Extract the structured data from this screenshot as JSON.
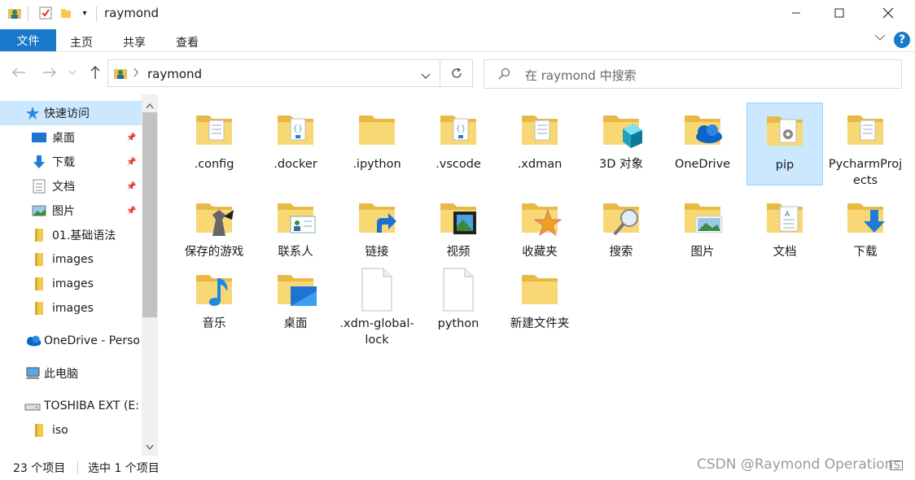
{
  "window": {
    "title": "raymond"
  },
  "ribbon": {
    "tabs": [
      "文件",
      "主页",
      "共享",
      "查看"
    ]
  },
  "address": {
    "path": "raymond",
    "search_placeholder": "在 raymond 中搜索"
  },
  "nav": {
    "items": [
      {
        "label": "快速访问",
        "icon": "star-icon"
      },
      {
        "label": "桌面",
        "icon": "desktop-icon",
        "pinned": true
      },
      {
        "label": "下载",
        "icon": "download-icon",
        "pinned": true
      },
      {
        "label": "文档",
        "icon": "document-icon",
        "pinned": true
      },
      {
        "label": "图片",
        "icon": "pictures-icon",
        "pinned": true
      },
      {
        "label": "01.基础语法",
        "icon": "folder-icon"
      },
      {
        "label": "images",
        "icon": "folder-icon"
      },
      {
        "label": "images",
        "icon": "folder-icon"
      },
      {
        "label": "images",
        "icon": "folder-icon"
      },
      {
        "label": "OneDrive - Perso",
        "icon": "onedrive-icon"
      },
      {
        "label": "此电脑",
        "icon": "computer-icon"
      },
      {
        "label": "TOSHIBA EXT (E:",
        "icon": "drive-icon"
      },
      {
        "label": "iso",
        "icon": "folder-icon"
      }
    ]
  },
  "files": [
    {
      "name": ".config",
      "kind": "folder-docs"
    },
    {
      "name": ".docker",
      "kind": "folder-code"
    },
    {
      "name": ".ipython",
      "kind": "folder"
    },
    {
      "name": ".vscode",
      "kind": "folder-code"
    },
    {
      "name": ".xdman",
      "kind": "folder-docs"
    },
    {
      "name": "3D 对象",
      "kind": "folder-3d"
    },
    {
      "name": "OneDrive",
      "kind": "folder-onedrive"
    },
    {
      "name": "pip",
      "kind": "folder-gear"
    },
    {
      "name": "PycharmProjects",
      "kind": "folder-docs"
    },
    {
      "name": "保存的游戏",
      "kind": "folder-games"
    },
    {
      "name": "联系人",
      "kind": "folder-contacts"
    },
    {
      "name": "链接",
      "kind": "folder-links"
    },
    {
      "name": "视频",
      "kind": "folder-video"
    },
    {
      "name": "收藏夹",
      "kind": "folder-star"
    },
    {
      "name": "搜索",
      "kind": "folder-search"
    },
    {
      "name": "图片",
      "kind": "folder-pictures"
    },
    {
      "name": "文档",
      "kind": "folder-documents"
    },
    {
      "name": "下载",
      "kind": "folder-download"
    },
    {
      "name": "音乐",
      "kind": "folder-music"
    },
    {
      "name": "桌面",
      "kind": "folder-desktop"
    },
    {
      "name": ".xdm-global-lock",
      "kind": "file"
    },
    {
      "name": "python",
      "kind": "file"
    },
    {
      "name": "新建文件夹",
      "kind": "folder"
    }
  ],
  "status": {
    "count": "23 个项目",
    "selected": "选中 1 个项目"
  },
  "watermark": "CSDN @Raymond Operations",
  "colors": {
    "accent": "#1979ca",
    "selection": "#cce8ff",
    "folder": "#f8d775"
  }
}
